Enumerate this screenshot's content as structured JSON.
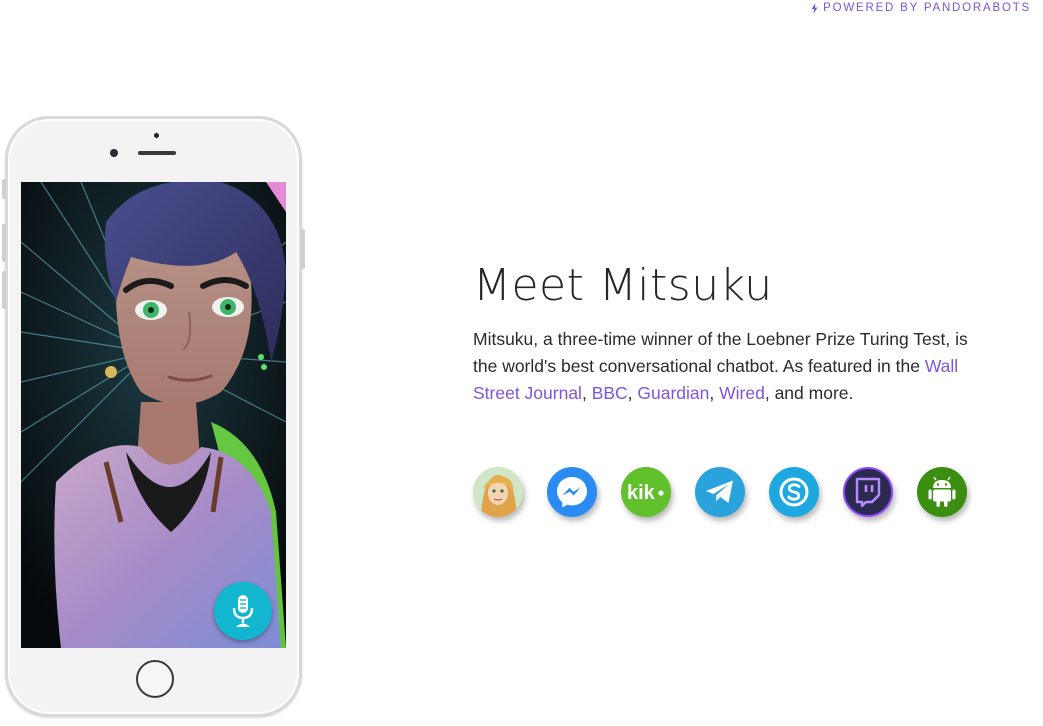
{
  "header": {
    "powered_by": "POWERED BY PANDORABOTS",
    "bolt_icon": "lightning-bolt-icon"
  },
  "main": {
    "title": "Meet Mitsuku",
    "description_part1": "Mitsuku, a three-time winner of the Loebner Prize Turing Test, is the world's best conversational chatbot. As featured in the ",
    "press_links": [
      "Wall Street Journal",
      "BBC",
      "Guardian",
      "Wired"
    ],
    "separator": ", ",
    "description_end": ", and more."
  },
  "phone": {
    "mic_icon": "microphone-icon",
    "avatar_image": "3d-avatar-mitsuku"
  },
  "channels": [
    {
      "name": "Web chat",
      "icon": "mitsuku-avatar-icon",
      "color": "#e0a86a"
    },
    {
      "name": "Messenger",
      "icon": "messenger-icon",
      "color": "#2a8cf2"
    },
    {
      "name": "Kik",
      "icon": "kik-icon",
      "color": "#62c02d"
    },
    {
      "name": "Telegram",
      "icon": "telegram-icon",
      "color": "#2aa3dc"
    },
    {
      "name": "Skype",
      "icon": "skype-icon",
      "color": "#1ea8e0"
    },
    {
      "name": "Twitch",
      "icon": "twitch-icon",
      "color": "#9146ff"
    },
    {
      "name": "Android",
      "icon": "android-icon",
      "color": "#3b8e0f"
    }
  ],
  "colors": {
    "accent": "#7f55de",
    "mic_button": "#13b6cf"
  }
}
